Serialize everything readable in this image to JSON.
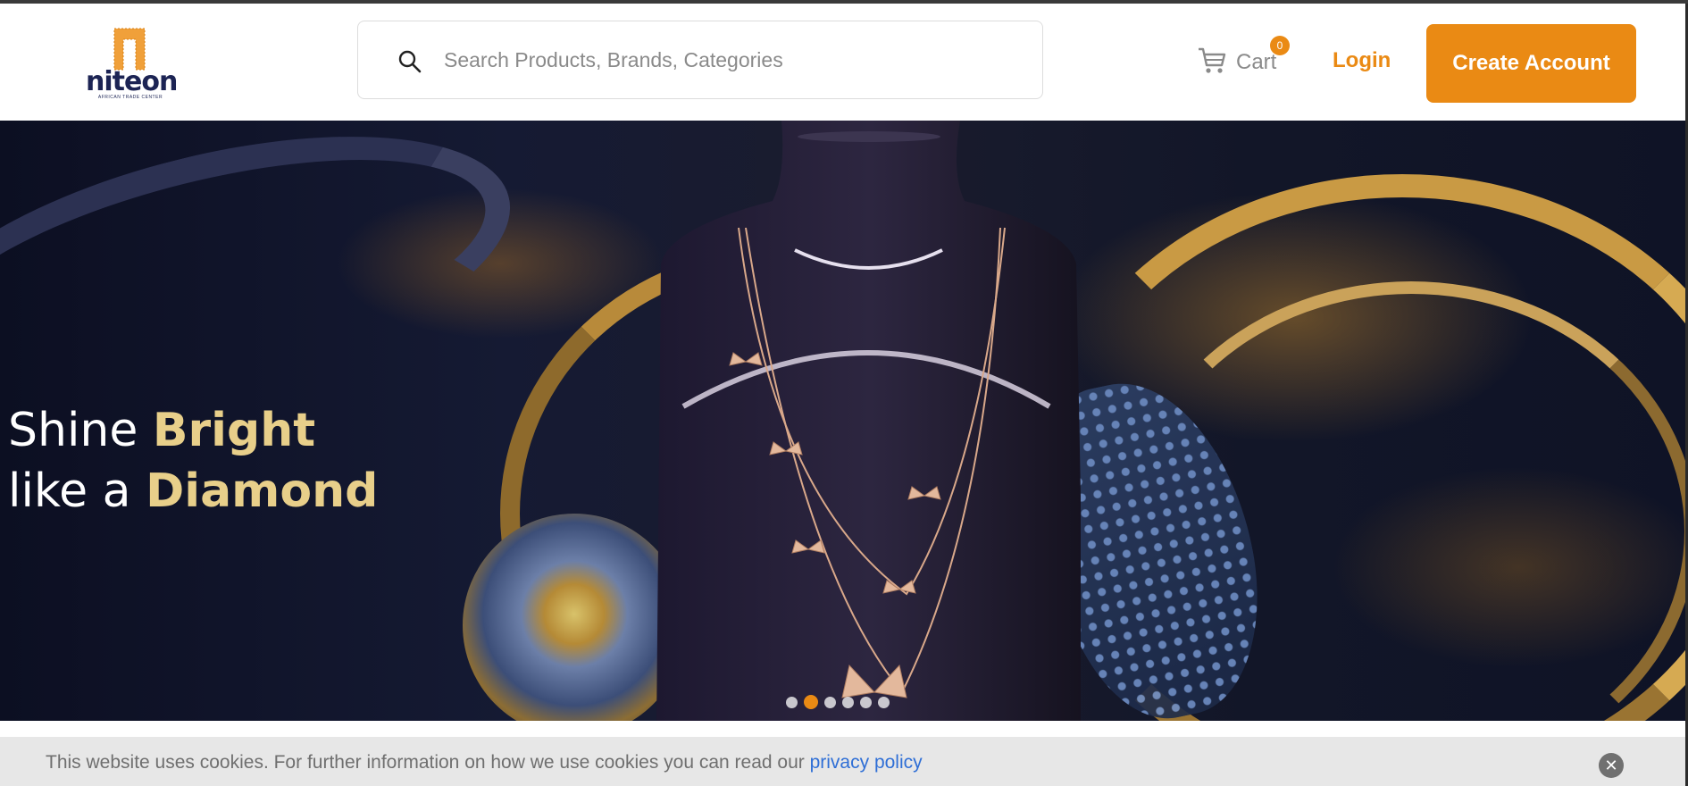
{
  "header": {
    "logo": {
      "name": "niteon",
      "tagline": "AFRICAN TRADE CENTER"
    },
    "search": {
      "placeholder": "Search Products, Brands, Categories",
      "value": ""
    },
    "cart": {
      "label": "Cart",
      "count": "0"
    },
    "login_label": "Login",
    "create_account_label": "Create Account"
  },
  "hero": {
    "tagline_line1_plain": "Shine ",
    "tagline_line1_highlight": "Bright",
    "tagline_line2_plain": "like a ",
    "tagline_line2_highlight": "Diamond",
    "slides_total": 6,
    "active_slide": 2
  },
  "cookie_banner": {
    "text": "This website uses cookies. For further information on how we use cookies you can read our ",
    "link_text": "privacy policy",
    "close_icon": "close-icon"
  },
  "colors": {
    "accent": "#ea8a14",
    "brand_navy": "#1c2454",
    "tagline_highlight": "#e8cf8a",
    "link_blue": "#2f6fd6"
  }
}
